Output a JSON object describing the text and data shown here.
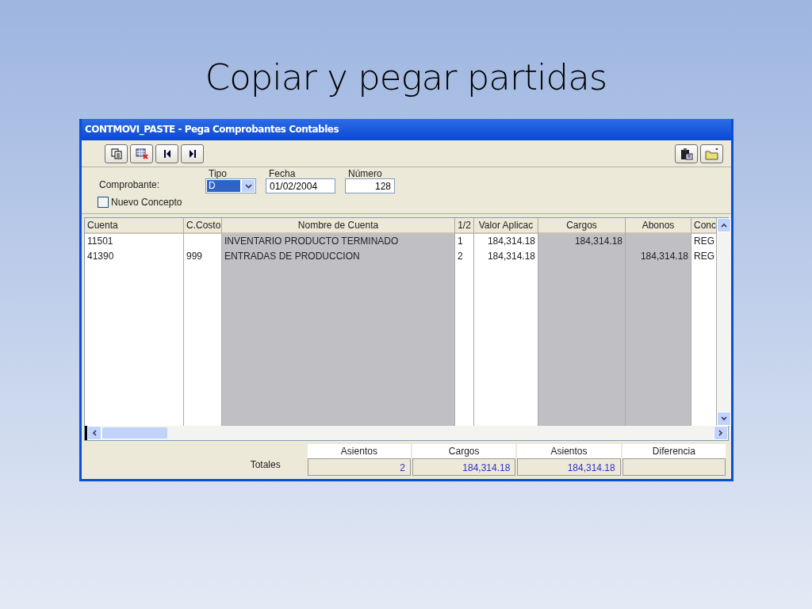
{
  "slide_title": "Copiar y pegar partidas",
  "window": {
    "title": "CONTMOVI_PASTE -  Pega Comprobantes Contables"
  },
  "form": {
    "label": "Comprobante:",
    "tipo": {
      "label": "Tipo",
      "value": "D"
    },
    "fecha": {
      "label": "Fecha",
      "value": "01/02/2004"
    },
    "numero": {
      "label": "Número",
      "value": "128"
    },
    "nuevo_concepto": {
      "label": "Nuevo Concepto",
      "checked": false
    }
  },
  "table": {
    "columns": [
      {
        "label": "Cuenta",
        "readonly": false
      },
      {
        "label": "C.Costo",
        "readonly": false
      },
      {
        "label": "Nombre de Cuenta",
        "readonly": true
      },
      {
        "label": "1/2",
        "readonly": false
      },
      {
        "label": "Valor Aplicac",
        "readonly": false
      },
      {
        "label": "Cargos",
        "readonly": true
      },
      {
        "label": "Abonos",
        "readonly": true
      },
      {
        "label": "Conc",
        "readonly": false
      }
    ],
    "rows": [
      [
        "11501",
        "",
        "INVENTARIO PRODUCTO TERMINADO",
        "1",
        "184,314.18",
        "184,314.18",
        "",
        "REG"
      ],
      [
        "41390",
        "999",
        "ENTRADAS DE PRODUCCION",
        "2",
        "184,314.18",
        "",
        "184,314.18",
        "REG"
      ]
    ]
  },
  "totals": {
    "label": "Totales",
    "items": [
      {
        "header": "Asientos",
        "value": "2"
      },
      {
        "header": "Cargos",
        "value": "184,314.18"
      },
      {
        "header": "Asientos",
        "value": "184,314.18"
      },
      {
        "header": "Diferencia"
      }
    ]
  }
}
